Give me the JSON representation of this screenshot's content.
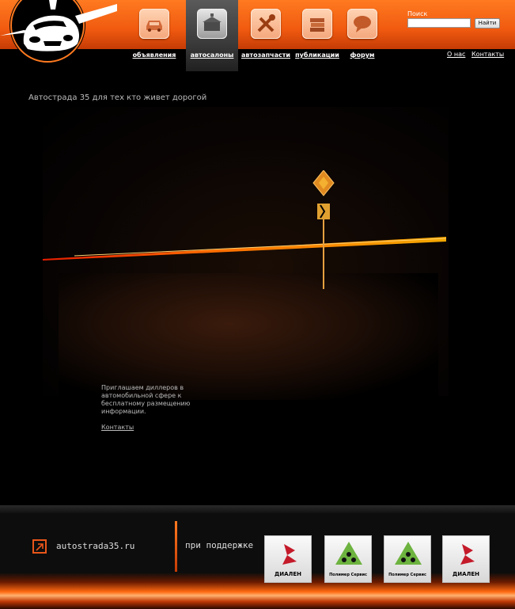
{
  "nav": {
    "items": [
      {
        "label": "объявления",
        "icon": "car-icon",
        "active": false
      },
      {
        "label": "автосалоны",
        "icon": "dealership-icon",
        "active": true
      },
      {
        "label": "автозапчасти",
        "icon": "tools-icon",
        "active": false
      },
      {
        "label": "публикации",
        "icon": "books-icon",
        "active": false
      },
      {
        "label": "форум",
        "icon": "speech-bubble-icon",
        "active": false
      }
    ]
  },
  "search": {
    "label": "Поиск",
    "value": "",
    "button_label": "Найти"
  },
  "top_links": {
    "about": "О нас",
    "contacts": "Контакты"
  },
  "main": {
    "tagline": "Автострада 35 для тех кто живет дорогой",
    "promo_text": "Приглашаем диллеров в автомобильной сфере к бесплатному размещению информации.",
    "promo_link": "Контакты"
  },
  "footer": {
    "site_name": "autostrada35.ru",
    "support_label": "при поддержке",
    "sponsors": [
      {
        "name": "ДИАЛЕН",
        "style": "red"
      },
      {
        "name": "Полимер Сервис",
        "style": "green"
      },
      {
        "name": "Полимер Сервис",
        "style": "green"
      },
      {
        "name": "ДИАЛЕН",
        "style": "red"
      }
    ]
  },
  "colors": {
    "accent": "#f05a10",
    "background": "#000000",
    "active_tab": "#3b3b3b"
  }
}
